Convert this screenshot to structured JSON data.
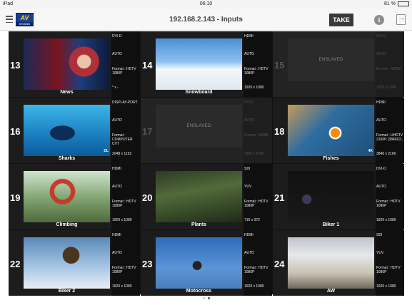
{
  "status_bar": {
    "device": "iPad",
    "time": "06:10",
    "battery": "81 %"
  },
  "header": {
    "title": "192.168.2.143 - Inputs",
    "take_label": "TAKE",
    "logo_text": "AV",
    "logo_sub": "STUDIO"
  },
  "inputs": [
    {
      "number": "13",
      "name": "News",
      "type": "DVI-D",
      "mode": "AUTO",
      "format": "Format : HDTV 1080P",
      "resolution": "* x -",
      "enslaved": false
    },
    {
      "number": "14",
      "name": "Snowboard",
      "type": "HDMI",
      "mode": "AUTO",
      "format": "Format : HDTV 1080P",
      "resolution": "1920 x 1080",
      "enslaved": false
    },
    {
      "number": "15",
      "name": "ENSLAVED",
      "type": "DVI-D",
      "mode": "AUTO",
      "format": "Format : NONE",
      "resolution": "1920 x 1080",
      "enslaved": true
    },
    {
      "number": "16",
      "name": "Sharks",
      "type": "DISPLAY-PORT",
      "mode": "AUTO",
      "format": "Format : COMPUTER CVT",
      "resolution": "2048 x 1152",
      "enslaved": false,
      "tag": "DL"
    },
    {
      "number": "17",
      "name": "ENSLAVED",
      "type": "DVI-D",
      "mode": "AUTO",
      "format": "Format : NONE",
      "resolution": "1920 x 1080",
      "enslaved": true
    },
    {
      "number": "18",
      "name": "Fishes",
      "type": "HDMI",
      "mode": "AUTO",
      "format": "Format : UHDTV 2160P (3840X2...",
      "resolution": "3840 x 2160",
      "enslaved": false,
      "tag": "4K"
    },
    {
      "number": "19",
      "name": "Climbing",
      "type": "HDMI",
      "mode": "AUTO",
      "format": "Format : HDTV 1080P",
      "resolution": "1920 x 1080",
      "enslaved": false
    },
    {
      "number": "20",
      "name": "Plants",
      "type": "SDI",
      "mode": "YUV",
      "format": "Format : HDTV 1080P",
      "resolution": "716 x 372",
      "enslaved": false
    },
    {
      "number": "21",
      "name": "Biker 1",
      "type": "DVI-D",
      "mode": "AUTO",
      "format": "Format : HDTV 1080P",
      "resolution": "1920 x 1080",
      "enslaved": false
    },
    {
      "number": "22",
      "name": "Biker 2",
      "type": "HDMI",
      "mode": "AUTO",
      "format": "Format : HDTV 1080P",
      "resolution": "1920 x 1080",
      "enslaved": false
    },
    {
      "number": "23",
      "name": "Motocross",
      "type": "HDMI",
      "mode": "AUTO",
      "format": "Format : HDTV 1080P",
      "resolution": "1920 x 1080",
      "enslaved": false
    },
    {
      "number": "24",
      "name": "AW",
      "type": "SDI",
      "mode": "YUV",
      "format": "Format : HDTV 1080P",
      "resolution": "1920 x 1080",
      "enslaved": false
    }
  ],
  "pagination": {
    "pages": 2,
    "current": 2
  }
}
